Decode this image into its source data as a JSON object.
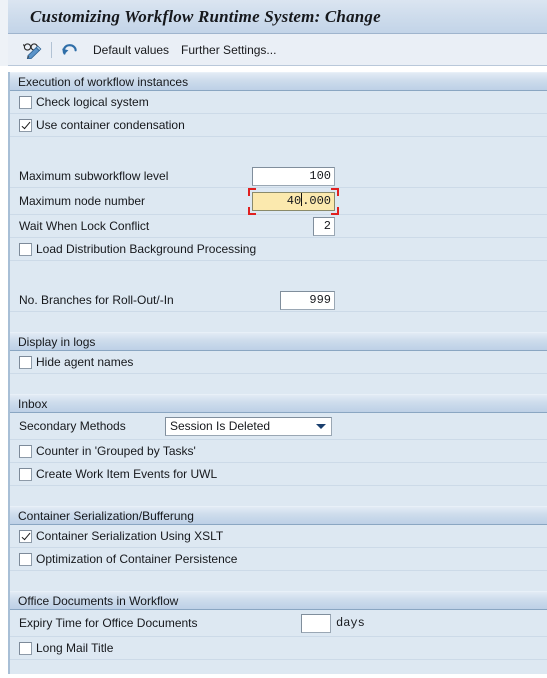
{
  "window": {
    "title": "Customizing Workflow Runtime System: Change"
  },
  "toolbar": {
    "display_change_icon": "glasses-pencil-icon",
    "undo_icon": "undo-arrow-icon",
    "default_values_label": "Default values",
    "further_settings_label": "Further Settings..."
  },
  "groups": {
    "execution": {
      "header": "Execution of workflow instances",
      "check_logical_system": {
        "label": "Check logical system",
        "checked": false
      },
      "use_container_condensation": {
        "label": "Use container condensation",
        "checked": true
      },
      "max_subworkflow_level": {
        "label": "Maximum subworkflow level",
        "value": "100"
      },
      "max_node_number": {
        "label": "Maximum node number",
        "value_before_caret": "40",
        "value_after_caret": ".000",
        "value": "40.000",
        "focused": true
      },
      "wait_lock_conflict": {
        "label": "Wait When Lock Conflict",
        "value": "2"
      },
      "load_distribution": {
        "label": "Load Distribution Background Processing",
        "checked": false
      },
      "branches_rollout": {
        "label": "No. Branches for Roll-Out/-In",
        "value": "999"
      }
    },
    "display_logs": {
      "header": "Display in logs",
      "hide_agent_names": {
        "label": "Hide agent names",
        "checked": false
      }
    },
    "inbox": {
      "header": "Inbox",
      "secondary_methods": {
        "label": "Secondary Methods",
        "selected": "Session Is Deleted"
      },
      "counter_grouped": {
        "label": "Counter in 'Grouped by Tasks'",
        "checked": false
      },
      "create_work_item_events": {
        "label": "Create Work Item Events for UWL",
        "checked": false
      }
    },
    "container_serialization": {
      "header": "Container Serialization/Bufferung",
      "serialization_xslt": {
        "label": "Container Serialization Using XSLT",
        "checked": true
      },
      "optimization_persistence": {
        "label": "Optimization of Container Persistence",
        "checked": false
      }
    },
    "office_documents": {
      "header": "Office Documents in Workflow",
      "expiry_time": {
        "label": "Expiry Time for Office Documents",
        "value": "",
        "unit": "days"
      },
      "long_mail_title": {
        "label": "Long Mail Title",
        "checked": false
      }
    }
  },
  "colors": {
    "titlebar": "#cedcec",
    "panel_bg": "#dde8f2",
    "group_header": "#bdd0e6",
    "focus_field_bg": "#fbe9ae",
    "focus_marker": "#e02020"
  }
}
